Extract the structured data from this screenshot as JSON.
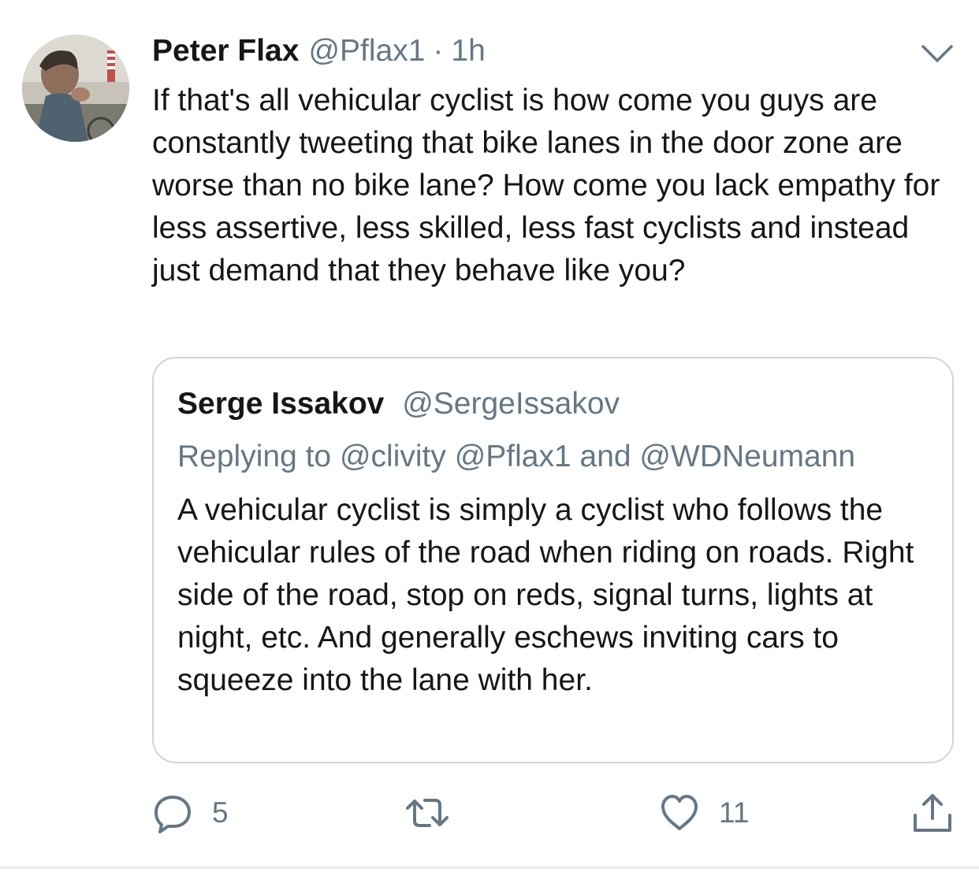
{
  "tweet": {
    "author_name": "Peter Flax",
    "author_handle": "@Pflax1",
    "separator": "·",
    "time": "1h",
    "text": "If that's all vehicular cyclist is how come you guys are constantly tweeting that bike lanes in the door zone are worse than no bike lane? How come you lack empathy for less assertive, less skilled, less fast cyclists and instead just demand that they behave like you?"
  },
  "quoted_tweet": {
    "author_name": "Serge Issakov",
    "author_handle": "@SergeIssakov",
    "replying_to": "Replying to @clivity @Pflax1 and @WDNeumann",
    "text": "A vehicular cyclist is simply a cyclist who follows the vehicular rules of the road when riding on roads.  Right side of the road, stop on reds, signal turns, lights at night, etc. And generally eschews inviting cars to squeeze into the lane with her."
  },
  "actions": {
    "reply_icon": "reply-icon",
    "reply_count": "5",
    "retweet_icon": "retweet-icon",
    "like_icon": "heart-icon",
    "like_count": "11",
    "share_icon": "share-icon"
  },
  "colors": {
    "text": "#14171a",
    "secondary": "#657786",
    "border": "#ccd6dd",
    "divider": "#e6ecf0"
  }
}
